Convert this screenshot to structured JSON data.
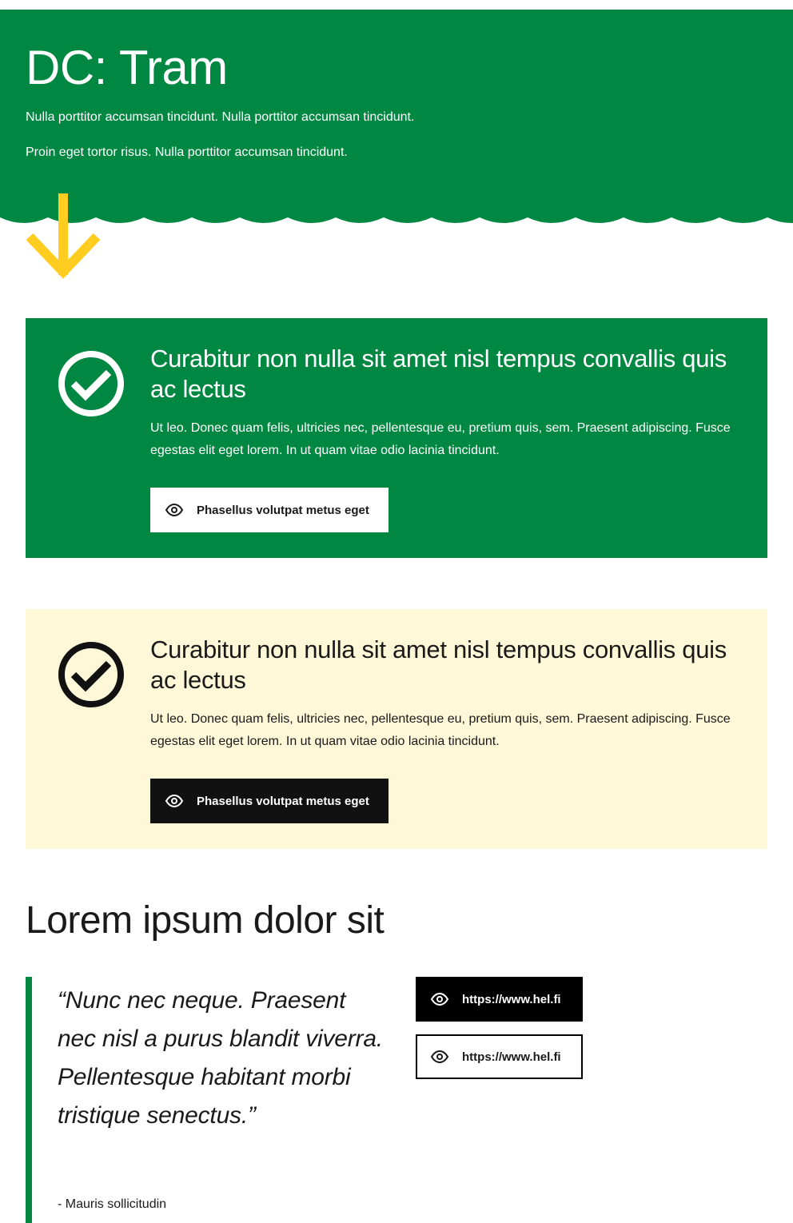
{
  "hero": {
    "title": "DC: Tram",
    "text1": "Nulla porttitor accumsan tincidunt. Nulla porttitor accumsan tincidunt.",
    "text2": "Proin eget tortor risus. Nulla porttitor accumsan tincidunt.",
    "background_color": "#008741",
    "arrow_color": "#ffcd1f"
  },
  "notices": [
    {
      "variant": "green",
      "icon": "check-circle-icon",
      "title": "Curabitur non nulla sit amet nisl tempus convallis quis ac lectus",
      "text": "Ut leo. Donec quam felis, ultricies nec, pellentesque eu, pretium quis, sem. Praesent adipiscing. Fusce egestas elit eget lorem. In ut quam vitae odio lacinia tincidunt.",
      "button_label": "Phasellus volutpat metus eget",
      "button_icon": "eye-icon"
    },
    {
      "variant": "yellow",
      "icon": "check-circle-icon",
      "title": "Curabitur non nulla sit amet nisl tempus convallis quis ac lectus",
      "text": "Ut leo. Donec quam felis, ultricies nec, pellentesque eu, pretium quis, sem. Praesent adipiscing. Fusce egestas elit eget lorem. In ut quam vitae odio lacinia tincidunt.",
      "button_label": "Phasellus volutpat metus eget",
      "button_icon": "eye-icon"
    }
  ],
  "section": {
    "heading": "Lorem ipsum dolor sit",
    "quote": "“Nunc nec neque. Praesent nec nisl a purus blandit viverra. Pellentesque habitant morbi tristique senectus.”",
    "author": "- Mauris sollicitudin",
    "accent_color": "#008741",
    "links": [
      {
        "label": "https://www.hel.fi",
        "style": "dark",
        "icon": "eye-icon"
      },
      {
        "label": "https://www.hel.fi",
        "style": "light",
        "icon": "eye-icon"
      }
    ]
  }
}
